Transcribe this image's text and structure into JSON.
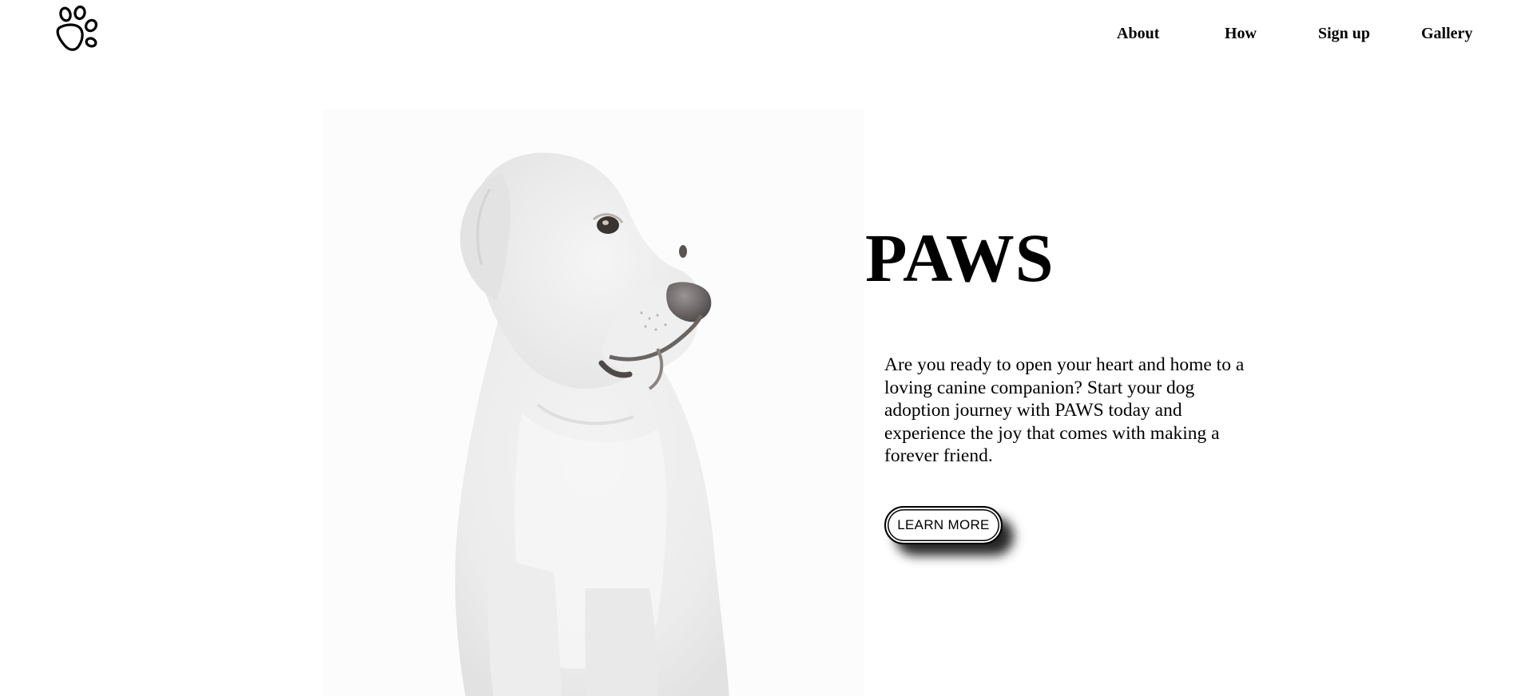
{
  "header": {
    "logo_icon": "paw-print-icon",
    "nav": [
      {
        "label": "About"
      },
      {
        "label": "How"
      },
      {
        "label": "Sign up"
      },
      {
        "label": "Gallery"
      }
    ]
  },
  "hero": {
    "image_subject": "white-labrador-dog-photo",
    "title": "PAWS",
    "description": "Are you ready to open your heart and home to a loving canine companion? Start your dog adoption journey with PAWS today and experience the joy that comes with making a forever friend.",
    "cta_label": "LEARN MORE"
  },
  "colors": {
    "text": "#000000",
    "background": "#ffffff",
    "image_background": "#fcfcfc"
  }
}
